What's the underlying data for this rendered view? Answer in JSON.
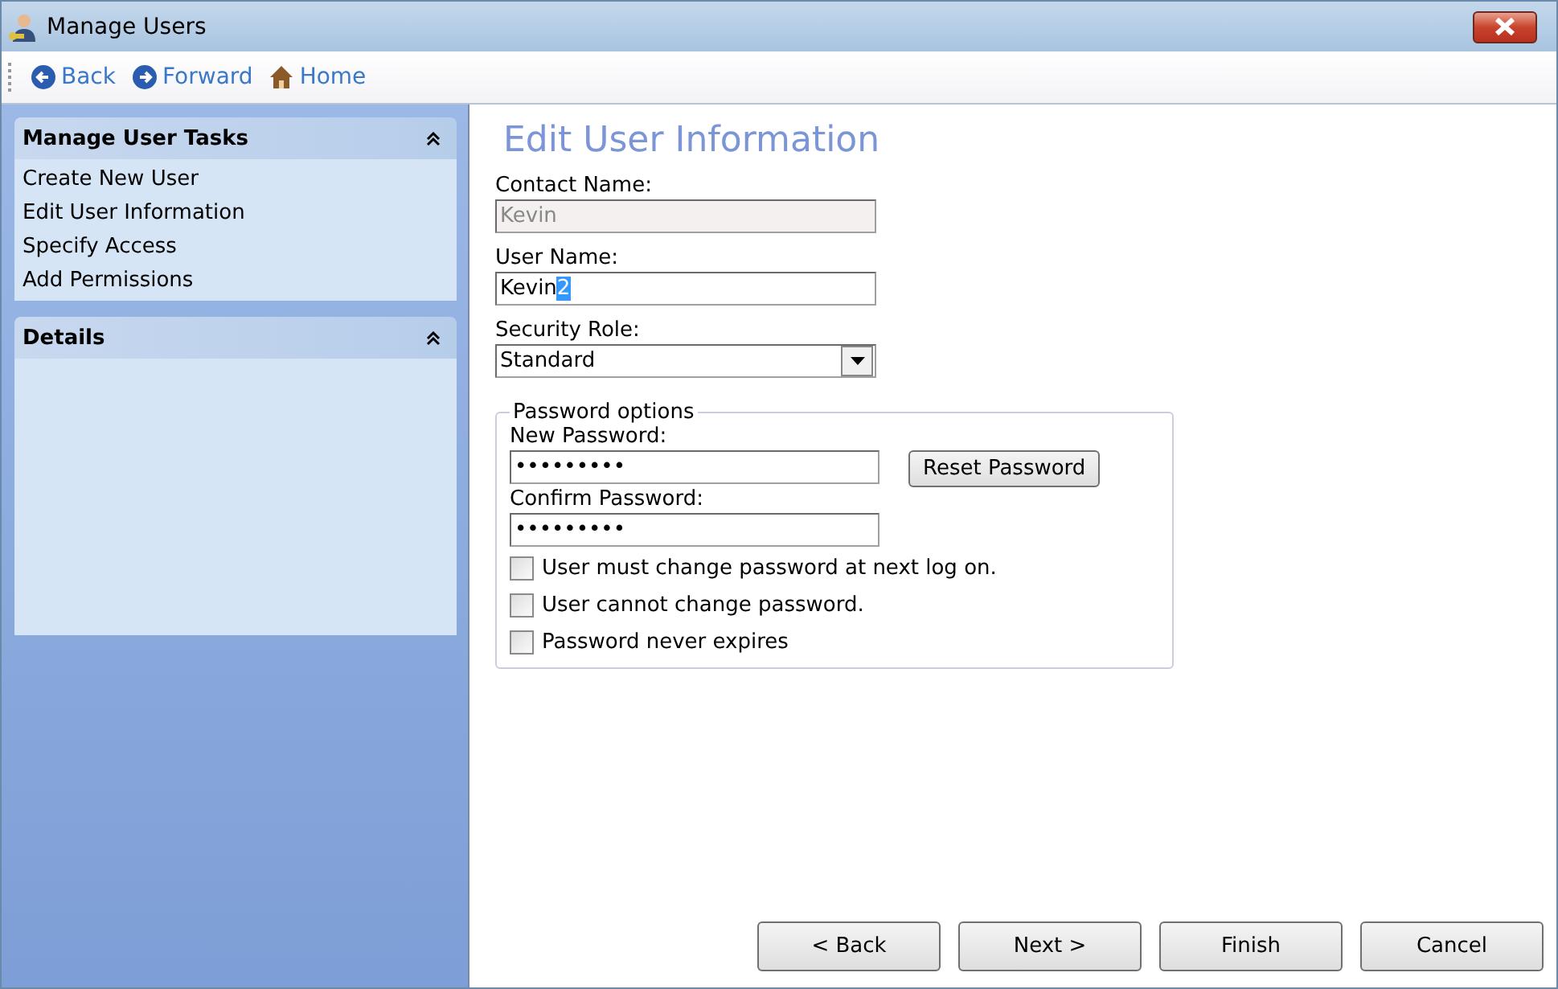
{
  "window": {
    "title": "Manage Users"
  },
  "toolbar": [
    {
      "label": "Back",
      "kind": "back"
    },
    {
      "label": "Forward",
      "kind": "forward"
    },
    {
      "label": "Home",
      "kind": "home"
    }
  ],
  "sidebar": {
    "sections": [
      {
        "title": "Manage User Tasks",
        "expanded": true,
        "items": [
          "Create New User",
          "Edit User Information",
          "Specify Access",
          "Add Permissions"
        ]
      },
      {
        "title": "Details",
        "expanded": true
      }
    ]
  },
  "form": {
    "heading": "Edit User Information",
    "contact_name": {
      "label": "Contact Name:",
      "value": "Kevin",
      "disabled": true
    },
    "user_name": {
      "label": "User Name:",
      "value": "Kevin",
      "selected_text": "2"
    },
    "security_role": {
      "label": "Security Role:",
      "value": "Standard"
    },
    "password_options": {
      "legend": "Password options",
      "new_password": {
        "label": "New Password:",
        "value": "•••••••••"
      },
      "confirm_password": {
        "label": "Confirm Password:",
        "value": "•••••••••"
      },
      "reset_button": "Reset Password",
      "checkboxes": [
        {
          "label": "User must change password at next log on.",
          "checked": false
        },
        {
          "label": "User cannot change password.",
          "checked": false
        },
        {
          "label": "Password never expires",
          "checked": false
        }
      ]
    }
  },
  "buttons": [
    "< Back",
    "Next >",
    "Finish",
    "Cancel"
  ]
}
